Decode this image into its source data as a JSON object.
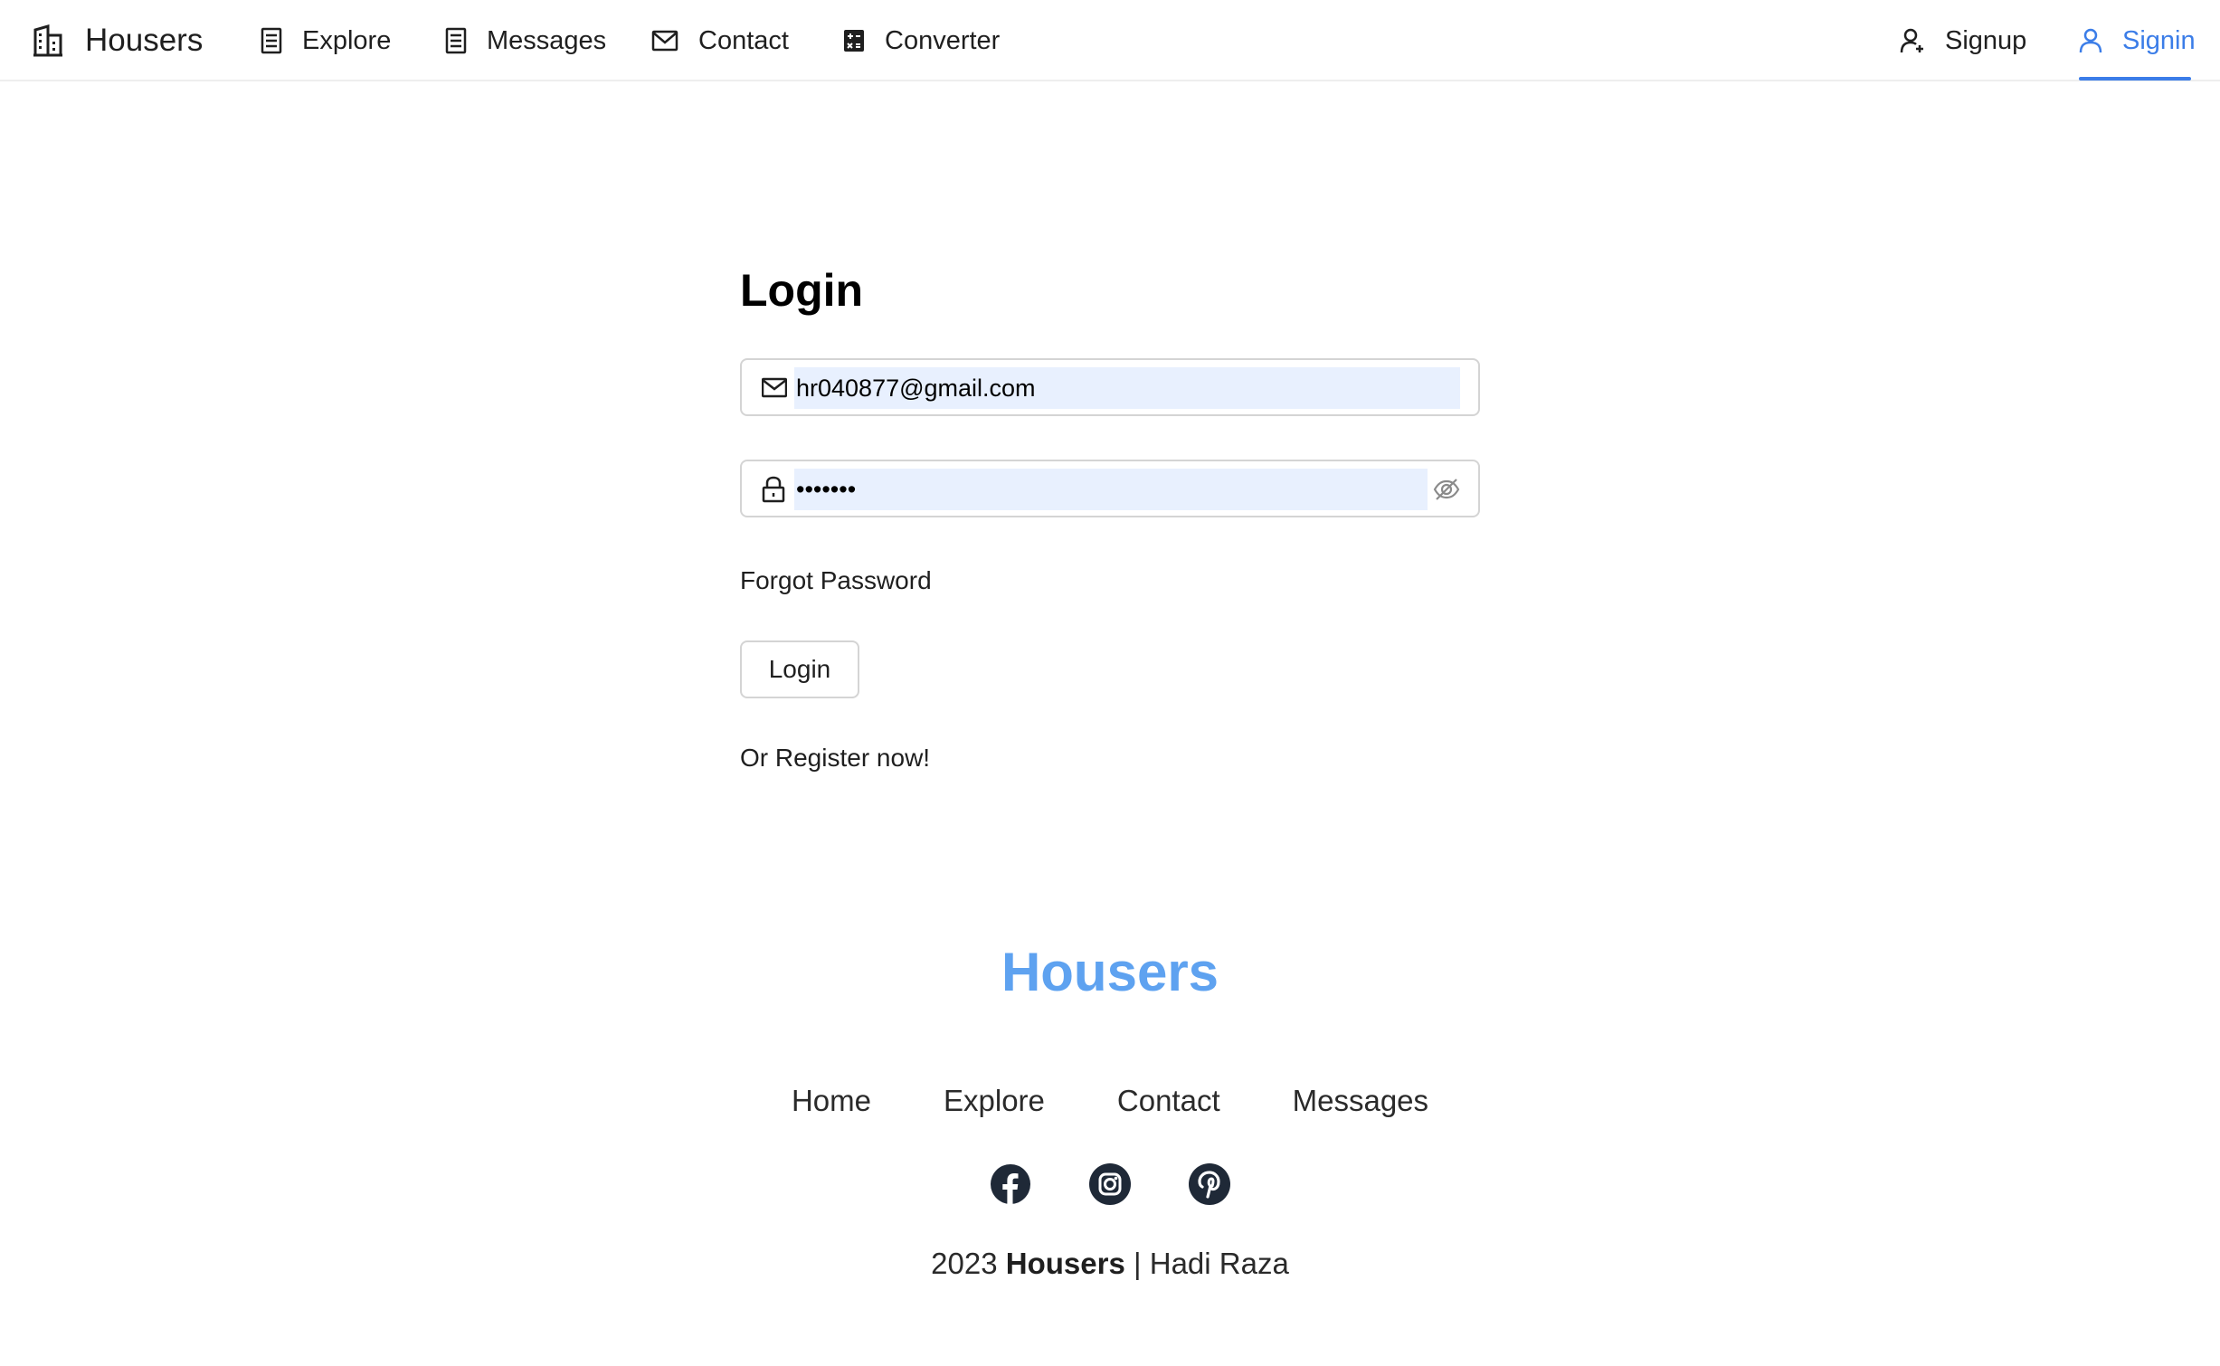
{
  "nav": {
    "brand": "Housers",
    "items": [
      {
        "label": "Explore",
        "icon": "list-icon"
      },
      {
        "label": "Messages",
        "icon": "list-icon"
      },
      {
        "label": "Contact",
        "icon": "mail-icon"
      },
      {
        "label": "Converter",
        "icon": "calculator-icon"
      }
    ],
    "signup": "Signup",
    "signin": "Signin",
    "active": "Signin",
    "accent_color": "#3b7de8"
  },
  "login": {
    "title": "Login",
    "email_value": "hr040877@gmail.com",
    "password_value": "•••••••",
    "forgot_password": "Forgot Password",
    "button": "Login",
    "register": "Or Register now!"
  },
  "footer": {
    "brand": "Housers",
    "brand_color": "#5ea2f0",
    "links": [
      "Home",
      "Explore",
      "Contact",
      "Messages"
    ],
    "socials": [
      "facebook-icon",
      "instagram-icon",
      "pinterest-icon"
    ],
    "year": "2023",
    "brand_bold": "Housers",
    "separator": "|",
    "author": "Hadi Raza"
  }
}
